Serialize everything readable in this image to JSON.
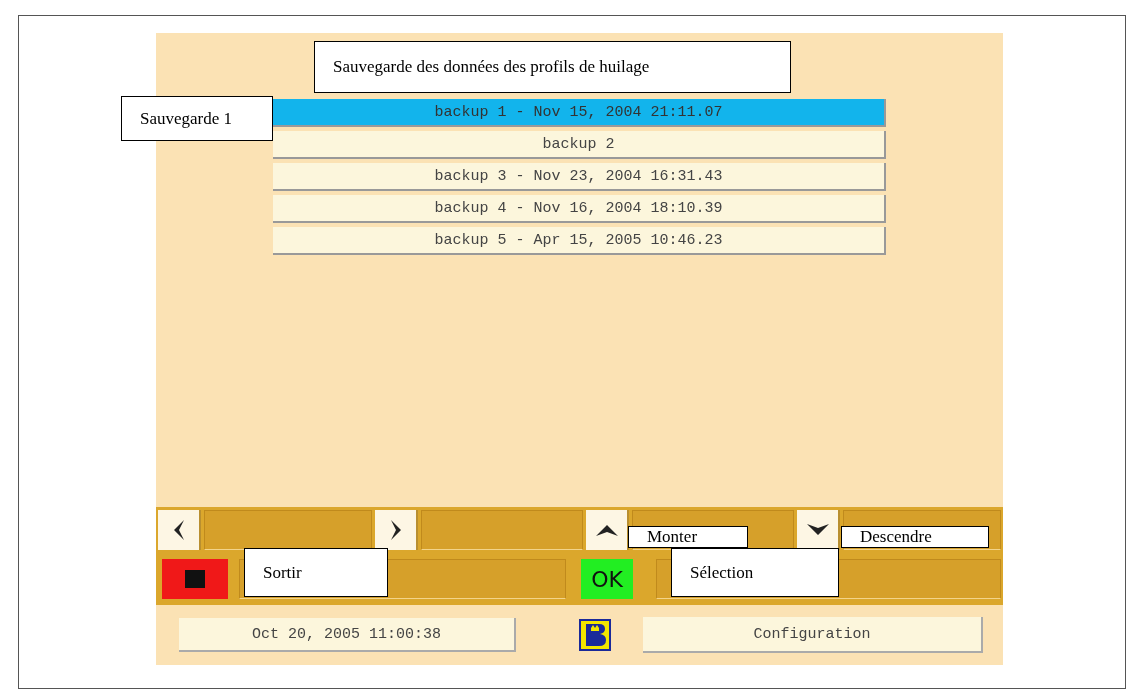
{
  "backups": [
    {
      "label": "backup 1 - Nov 15, 2004 21:11.07",
      "selected": true
    },
    {
      "label": "backup 2",
      "selected": false
    },
    {
      "label": "backup 3 - Nov 23, 2004 16:31.43",
      "selected": false
    },
    {
      "label": "backup 4 - Nov 16, 2004 18:10.39",
      "selected": false
    },
    {
      "label": "backup 5 - Apr 15, 2005 10:46.23",
      "selected": false
    }
  ],
  "ok_button": {
    "label": "OK"
  },
  "status": {
    "datetime": "Oct 20, 2005 11:00:38",
    "config_button": "Configuration"
  },
  "callouts": [
    {
      "text": "Sauvegarde des données des profils de huilage"
    },
    {
      "text": "Sauvegarde 1"
    },
    {
      "text": "Monter"
    },
    {
      "text": "Descendre"
    },
    {
      "text": "Sortir"
    },
    {
      "text": "Sélection"
    }
  ]
}
